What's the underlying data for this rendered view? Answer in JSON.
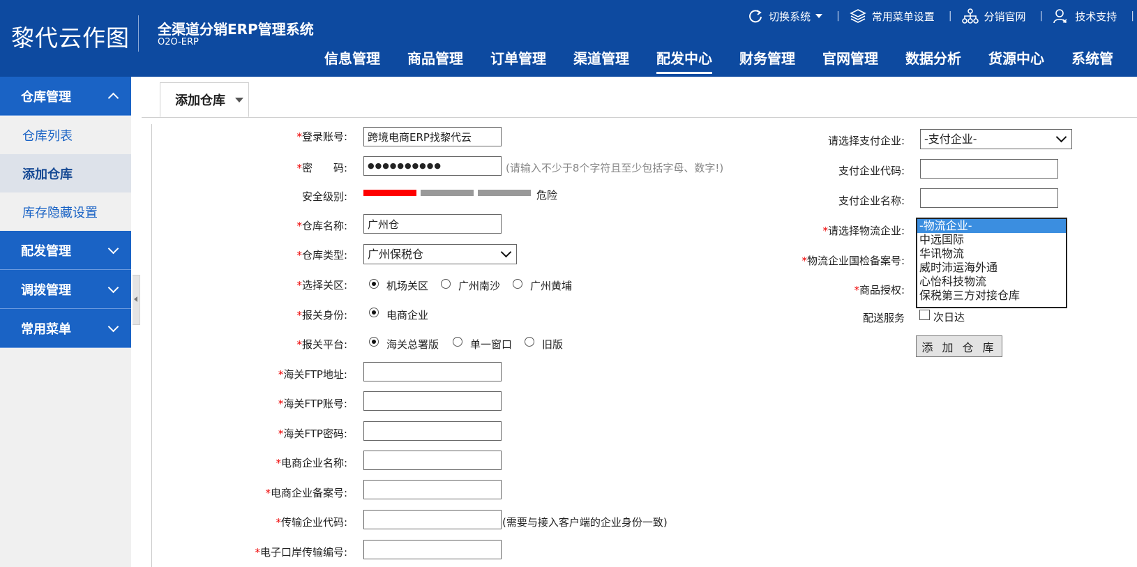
{
  "header": {
    "logo": "黎代云作图",
    "system_name": "全渠道分销ERP管理系统",
    "system_sub": "O2O-ERP",
    "top_links": [
      {
        "label": "切换系统",
        "icon": "refresh-icon"
      },
      {
        "label": "常用菜单设置",
        "icon": "layers-icon"
      },
      {
        "label": "分销官网",
        "icon": "network-icon"
      },
      {
        "label": "技术支持",
        "icon": "user-support-icon"
      }
    ],
    "separator": "|",
    "nav": [
      {
        "label": "信息管理",
        "active": false
      },
      {
        "label": "商品管理",
        "active": false
      },
      {
        "label": "订单管理",
        "active": false
      },
      {
        "label": "渠道管理",
        "active": false
      },
      {
        "label": "配发中心",
        "active": true
      },
      {
        "label": "财务管理",
        "active": false
      },
      {
        "label": "官网管理",
        "active": false
      },
      {
        "label": "数据分析",
        "active": false
      },
      {
        "label": "货源中心",
        "active": false
      },
      {
        "label": "系统管",
        "active": false
      }
    ]
  },
  "sidebar": {
    "groups": [
      {
        "label": "仓库管理",
        "expanded": true
      },
      {
        "label": "配发管理",
        "expanded": false
      },
      {
        "label": "调拨管理",
        "expanded": false
      },
      {
        "label": "常用菜单",
        "expanded": false
      }
    ],
    "items": [
      {
        "label": "仓库列表",
        "active": false
      },
      {
        "label": "添加仓库",
        "active": true
      },
      {
        "label": "库存隐藏设置",
        "active": false
      }
    ]
  },
  "tab": {
    "label": "添加仓库"
  },
  "form": {
    "required_mark": "*",
    "login_account": {
      "label": "登录账号:",
      "value": "跨境电商ERP找黎代云"
    },
    "password": {
      "label": "密　　码:",
      "value": "●●●●●●●●●●",
      "hint": "(请输入不少于8个字符且至少包括字母、数字!)"
    },
    "security": {
      "label": "安全级别:",
      "level_text": "危险",
      "level": 1,
      "levels_total": 3
    },
    "warehouse_name": {
      "label": "仓库名称:",
      "value": "广州仓"
    },
    "warehouse_type": {
      "label": "仓库类型:",
      "value": "广州保税仓"
    },
    "customs_zone": {
      "label": "选择关区:",
      "options": [
        "机场关区",
        "广州南沙",
        "广州黄埔"
      ],
      "selected": "机场关区"
    },
    "declare_identity": {
      "label": "报关身份:",
      "options": [
        "电商企业"
      ],
      "selected": "电商企业"
    },
    "declare_platform": {
      "label": "报关平台:",
      "options": [
        "海关总署版",
        "单一窗口",
        "旧版"
      ],
      "selected": "海关总署版"
    },
    "ftp_address": {
      "label": "海关FTP地址:",
      "value": ""
    },
    "ftp_account": {
      "label": "海关FTP账号:",
      "value": ""
    },
    "ftp_password": {
      "label": "海关FTP密码:",
      "value": ""
    },
    "ecom_name": {
      "label": "电商企业名称:",
      "value": ""
    },
    "ecom_record": {
      "label": "电商企业备案号:",
      "value": ""
    },
    "transfer_code": {
      "label": "传输企业代码:",
      "value": "",
      "hint": "(需要与接入客户端的企业身份一致)"
    },
    "eport_code": {
      "label": "电子口岸传输编号:",
      "value": ""
    },
    "pay_company": {
      "label": "请选择支付企业:",
      "value": "-支付企业-"
    },
    "pay_code": {
      "label": "支付企业代码:",
      "value": ""
    },
    "pay_name": {
      "label": "支付企业名称:",
      "value": ""
    },
    "logistics": {
      "label": "请选择物流企业:",
      "options": [
        "-物流企业-",
        "中远国际",
        "华讯物流",
        "威时沛运海外通",
        "心怡科技物流",
        "保税第三方对接仓库"
      ],
      "selected": "-物流企业-"
    },
    "logistics_record": {
      "label": "物流企业国检备案号:"
    },
    "product_auth": {
      "label": "商品授权:"
    },
    "delivery": {
      "label": "配送服务",
      "option": "次日达",
      "checked": false
    },
    "submit": "添 加 仓 库"
  }
}
